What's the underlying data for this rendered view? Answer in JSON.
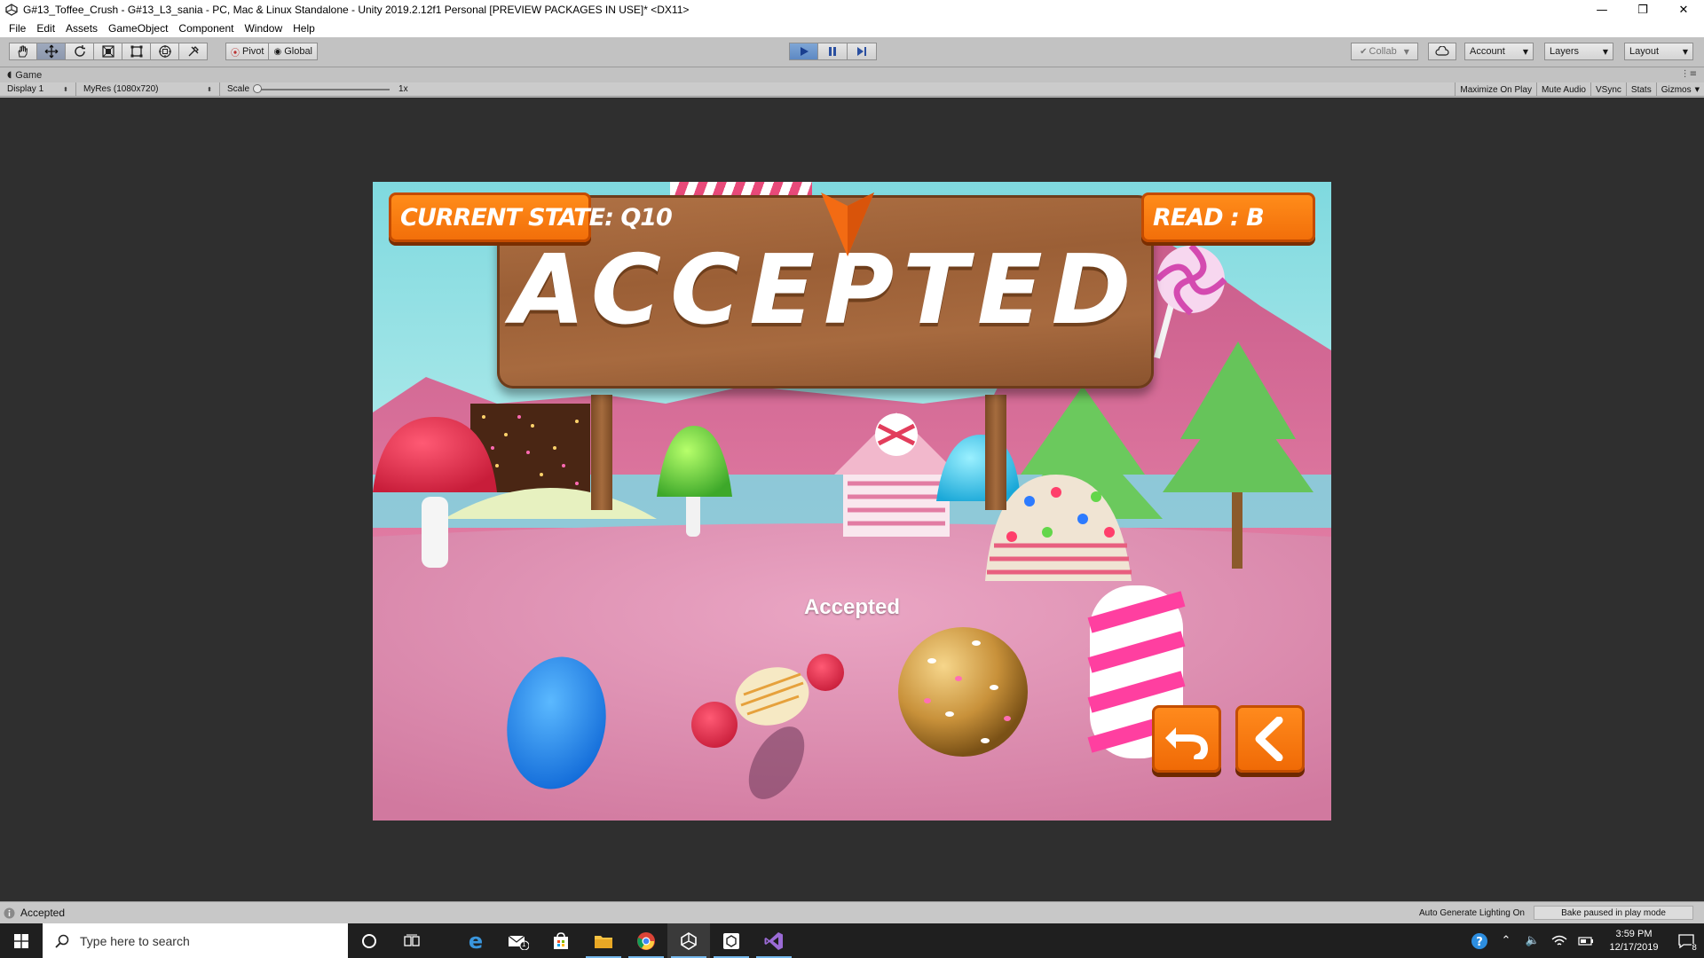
{
  "window": {
    "title": "G#13_Toffee_Crush - G#13_L3_sania - PC, Mac & Linux Standalone - Unity 2019.2.12f1 Personal [PREVIEW PACKAGES IN USE]* <DX11>",
    "minimize": "—",
    "maximize": "❐",
    "close": "✕"
  },
  "menu": [
    "File",
    "Edit",
    "Assets",
    "GameObject",
    "Component",
    "Window",
    "Help"
  ],
  "toolbar": {
    "tools": [
      "hand-tool-icon",
      "move-tool-icon",
      "rotate-tool-icon",
      "scale-tool-icon",
      "rect-tool-icon",
      "transform-tool-icon",
      "custom-tool-icon"
    ],
    "pivot_label": "Pivot",
    "global_label": "Global",
    "collab_label": "Collab",
    "account_label": "Account",
    "layers_label": "Layers",
    "layout_label": "Layout"
  },
  "game_tab": {
    "label": "Game",
    "display": "Display 1",
    "resolution": "MyRes (1080x720)",
    "scale_label": "Scale",
    "scale_value": "1x",
    "scale_fraction": 0,
    "buttons": [
      "Maximize On Play",
      "Mute Audio",
      "VSync",
      "Stats",
      "Gizmos"
    ]
  },
  "game": {
    "current_state": "CURRENT STATE: Q10",
    "read": "READ : B",
    "sign_text": "ACCEPTED",
    "center_label": "Accepted",
    "undo_icon": "undo-arrow-icon",
    "back_icon": "chevron-left-icon"
  },
  "status": {
    "message": "Accepted",
    "lighting": "Auto Generate Lighting On",
    "bake": "Bake paused in play mode"
  },
  "taskbar": {
    "search_placeholder": "Type here to search",
    "time": "3:59 PM",
    "date": "12/17/2019",
    "notification_count": "8",
    "mail_badge": "1"
  },
  "colors": {
    "accent_orange": "#f27a10",
    "play_blue": "#5d89c4",
    "editor_gray": "#c2c2c2",
    "taskbar": "#1f1f1f"
  }
}
